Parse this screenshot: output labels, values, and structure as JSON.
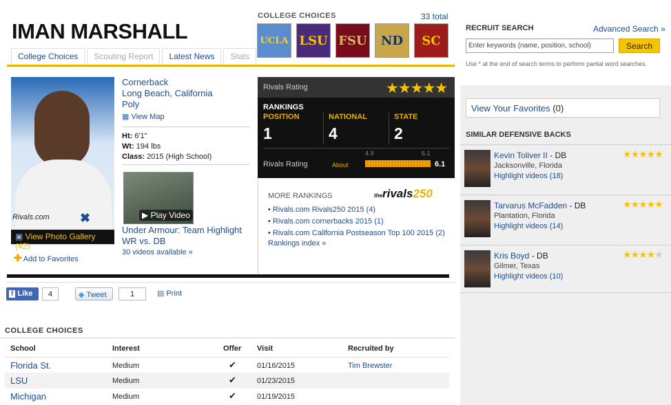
{
  "player": {
    "name": "IMAN MARSHALL",
    "position": "Cornerback",
    "hometown": "Long Beach, California",
    "school": "Poly",
    "view_map": "View Map",
    "height_label": "Ht:",
    "height": "6'1\"",
    "weight_label": "Wt:",
    "weight": "194 lbs",
    "class_label": "Class:",
    "class": "2015 (High School)",
    "photo_brand": "Rivals.com",
    "photo_gallery": "View Photo Gallery (42)",
    "add_favorites": "Add to Favorites"
  },
  "tabs": [
    {
      "label": "College Choices",
      "state": "active"
    },
    {
      "label": "Scouting Report",
      "state": "disabled"
    },
    {
      "label": "Latest News",
      "state": "active"
    },
    {
      "label": "Stats",
      "state": "disabled"
    }
  ],
  "college_choices_header": {
    "title": "COLLEGE CHOICES",
    "total": "33 total",
    "logos": [
      {
        "name": "ucla-logo",
        "text": "UCLA",
        "bg": "#5b8ccd",
        "fg": "#f5d130"
      },
      {
        "name": "lsu-logo",
        "text": "LSU",
        "bg": "#4a2a7a",
        "fg": "#f5c400"
      },
      {
        "name": "fsu-logo",
        "text": "FSU",
        "bg": "#7a0b1a",
        "fg": "#d4b56a"
      },
      {
        "name": "notre-dame-logo",
        "text": "ND",
        "bg": "#c9a64a",
        "fg": "#14325e"
      },
      {
        "name": "usc-logo",
        "text": "SC",
        "bg": "#9e1b1b",
        "fg": "#f5c400"
      }
    ]
  },
  "video": {
    "play_label": "Play Video",
    "title_line1": "Under Armour: Team Highlight",
    "title_line2": "WR vs. DB",
    "available": "30 videos available »"
  },
  "rankings": {
    "rivals_rating_label": "Rivals Rating",
    "stars": "★★★★★",
    "heading": "RANKINGS",
    "cols": [
      {
        "label": "POSITION",
        "value": "1"
      },
      {
        "label": "NATIONAL",
        "value": "4"
      },
      {
        "label": "STATE",
        "value": "2"
      }
    ],
    "rr_label": "Rivals Rating",
    "about": "About",
    "scale_min": "4.9",
    "scale_max": "6.1",
    "rating": "6.1",
    "rating_fraction": 1.0
  },
  "more_rankings": {
    "title": "MORE RANKINGS",
    "badge_the": "the",
    "badge_rivals": "rivals",
    "badge_num": "250",
    "items": [
      "Rivals.com Rivals250 2015 (4)",
      "Rivals.com cornerbacks 2015 (1)",
      "Rivals.com California Postseason Top 100 2015 (2)"
    ],
    "index": "Rankings index »"
  },
  "social": {
    "like": "Like",
    "like_count": "4",
    "tweet": "Tweet",
    "tweet_count": "1",
    "print": "Print"
  },
  "college_table": {
    "title": "COLLEGE CHOICES",
    "headers": [
      "School",
      "Interest",
      "Offer",
      "Visit",
      "Recruited by"
    ],
    "rows": [
      {
        "school": "Florida St.",
        "interest": "Medium",
        "offer": "✔",
        "visit": "01/16/2015",
        "recruited_by": "Tim Brewster"
      },
      {
        "school": "LSU",
        "interest": "Medium",
        "offer": "✔",
        "visit": "01/23/2015",
        "recruited_by": ""
      },
      {
        "school": "Michigan",
        "interest": "Medium",
        "offer": "✔",
        "visit": "01/19/2015",
        "recruited_by": ""
      }
    ]
  },
  "recruit_search": {
    "title": "RECRUIT SEARCH",
    "advanced": "Advanced Search »",
    "placeholder": "Enter keywords (name, position, school)",
    "button": "Search",
    "hint": "Use * at the end of search terms to perform partial word searches."
  },
  "favorites": {
    "label": "View Your Favorites",
    "count": "(0)"
  },
  "similar": {
    "title": "SIMILAR DEFENSIVE BACKS",
    "items": [
      {
        "name": "Kevin Toliver II",
        "pos": " - DB",
        "location": "Jacksonville, Florida",
        "highlights": "Highlight videos (18)",
        "stars_on": "★★★★★",
        "stars_off": ""
      },
      {
        "name": "Tarvarus McFadden",
        "pos": " - DB",
        "location": "Plantation, Florida",
        "highlights": "Highlight videos (14)",
        "stars_on": "★★★★★",
        "stars_off": ""
      },
      {
        "name": "Kris Boyd",
        "pos": " - DB",
        "location": "Gilmer, Texas",
        "highlights": "Highlight videos (10)",
        "stars_on": "★★★★",
        "stars_off": "★"
      }
    ]
  }
}
